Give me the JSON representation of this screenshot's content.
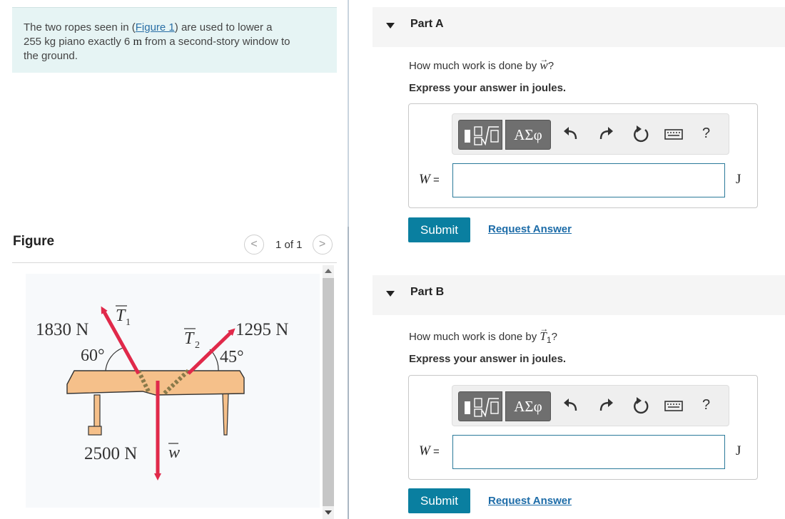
{
  "problem": {
    "text_before_link": "The two ropes seen in (",
    "link_text": "Figure 1",
    "text_after_link": ") are used to lower a",
    "line2_before_unit": "255 kg piano exactly 6 ",
    "unit": "m",
    "line2_after_unit": " from a second-story window to",
    "line3": "the ground."
  },
  "figure": {
    "heading": "Figure",
    "pager_count": "1 of 1",
    "prev_symbol": "<",
    "next_symbol": ">",
    "labels": {
      "force1": "1830 N",
      "angle1": "60°",
      "t1": "T",
      "t1_sub": "1",
      "t2": "T",
      "t2_sub": "2",
      "force2": "1295 N",
      "angle2": "45°",
      "weight": "2500 N",
      "w": "w"
    },
    "colors": {
      "arrow": "#e0294a",
      "piano": "#f5c08a",
      "piano_edge": "#333333"
    }
  },
  "parts": [
    {
      "title": "Part A",
      "question_before": "How much work is done by ",
      "question_var": "w",
      "question_sub": "",
      "question_after": "?",
      "instruction": "Express your answer in joules.",
      "toolbar_greek": "ΑΣφ",
      "help": "?",
      "input_label": "W",
      "input_eq": " =",
      "input_value": "",
      "unit": "J",
      "submit": "Submit",
      "request": "Request Answer"
    },
    {
      "title": "Part B",
      "question_before": "How much work is done by ",
      "question_var": "T",
      "question_sub": "1",
      "question_after": "?",
      "instruction": "Express your answer in joules.",
      "toolbar_greek": "ΑΣφ",
      "help": "?",
      "input_label": "W",
      "input_eq": " =",
      "input_value": "",
      "unit": "J",
      "submit": "Submit",
      "request": "Request Answer"
    }
  ],
  "theme": {
    "accent": "#0a7fa0",
    "link": "#1d6ca8",
    "problem_bg": "#e6f4f4",
    "part_header_bg": "#f5f5f5"
  }
}
